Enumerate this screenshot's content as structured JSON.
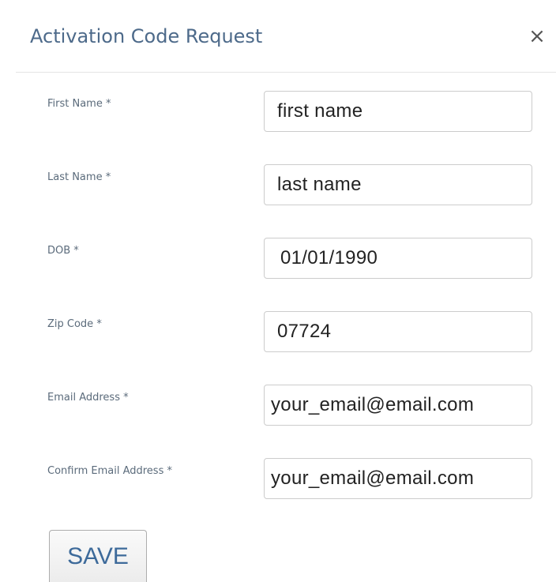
{
  "modal": {
    "title": "Activation Code Request",
    "close_label": "×"
  },
  "form": {
    "fields": [
      {
        "label": "First Name *",
        "value": "first name"
      },
      {
        "label": "Last Name *",
        "value": "last name"
      },
      {
        "label": "DOB *",
        "value": "01/01/1990"
      },
      {
        "label": "Zip Code *",
        "value": "07724"
      },
      {
        "label": "Email Address *",
        "value": "your_email@email.com"
      },
      {
        "label": "Confirm Email Address *",
        "value": "your_email@email.com"
      }
    ],
    "save_label": "SAVE"
  },
  "colors": {
    "title": "#4d6a8a",
    "label": "#5b6b7b",
    "button_text": "#3d6a9a"
  }
}
